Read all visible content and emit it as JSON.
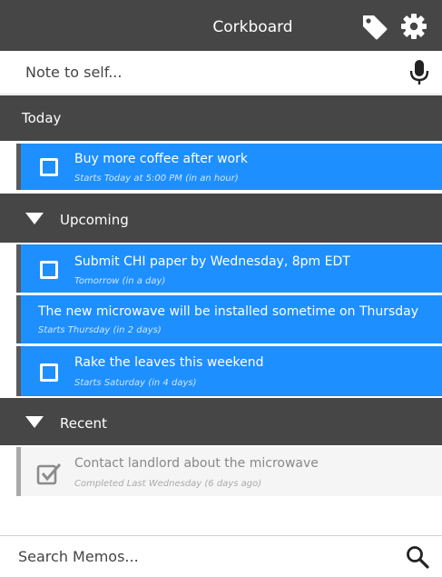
{
  "header": {
    "title": "Corkboard",
    "icons": [
      "tag-icon",
      "gear-icon"
    ]
  },
  "note_input": {
    "placeholder": "Note to self...",
    "icon": "mic-icon"
  },
  "sections": {
    "today": {
      "label": "Today",
      "items": [
        {
          "text": "Buy more coffee after work",
          "sub": "Starts Today at 5:00 PM (in an hour)"
        }
      ]
    },
    "upcoming": {
      "label": "Upcoming",
      "items": [
        {
          "text": "Submit CHI paper by Wednesday, 8pm EDT",
          "sub": "Tomorrow (in a day)"
        },
        {
          "text": "The new microwave will be installed sometime on Thursday",
          "sub": "Starts Thursday (in 2 days)"
        },
        {
          "text": "Rake the leaves this weekend",
          "sub": "Starts Saturday (in 4 days)"
        }
      ]
    },
    "recent": {
      "label": "Recent",
      "items": [
        {
          "text": "Contact landlord about the microwave",
          "sub": "Completed Last Wednesday (6 days ago)"
        }
      ]
    }
  },
  "search": {
    "placeholder": "Search Memos...",
    "icon": "search-icon"
  },
  "colors": {
    "header_bg": "#464646",
    "accent_blue": "#1e8fff",
    "completed_bg": "#f5f5f5"
  }
}
